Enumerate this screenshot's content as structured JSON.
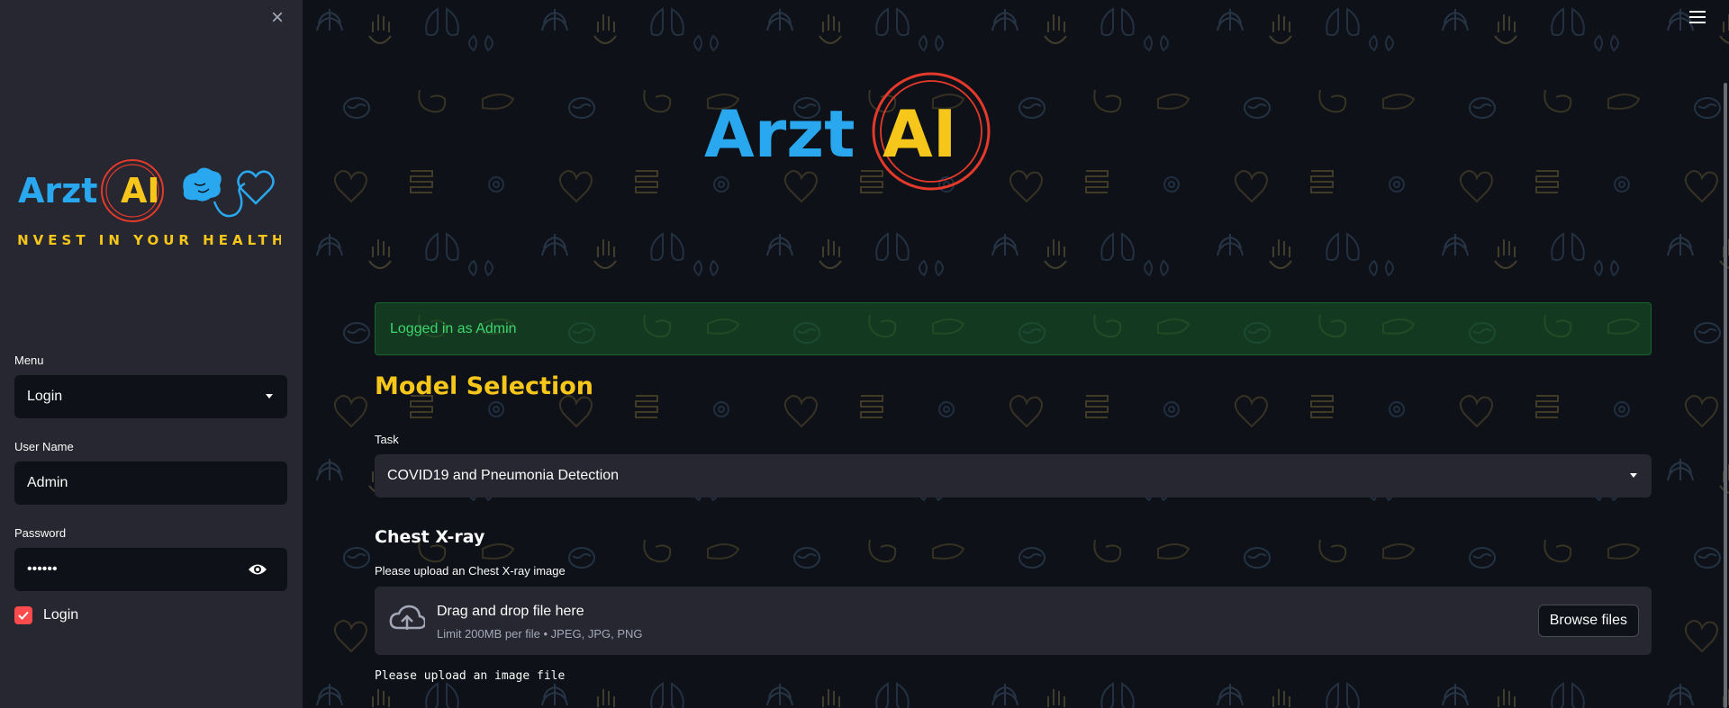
{
  "sidebar": {
    "close_glyph": "×",
    "logo": {
      "word1": "Arzt",
      "word2": "AI",
      "tagline": "INVEST IN YOUR HEALTH",
      "icons": [
        "brain-icon",
        "stethoscope-icon",
        "heart-icon"
      ]
    },
    "menu": {
      "label": "Menu",
      "value": "Login"
    },
    "username": {
      "label": "User Name",
      "value": "Admin"
    },
    "password": {
      "label": "Password",
      "value": "••••••"
    },
    "login_checkbox": {
      "label": "Login",
      "checked": true
    }
  },
  "main": {
    "hero_logo": {
      "word1": "Arzt",
      "word2": "AI"
    },
    "status": {
      "text": "Logged in as Admin"
    },
    "model_selection": {
      "heading": "Model Selection",
      "task_label": "Task",
      "task_value": "COVID19 and Pneumonia Detection"
    },
    "xray": {
      "heading": "Chest X-ray",
      "upload_label": "Please upload an Chest X-ray image",
      "drop_title": "Drag and drop file here",
      "drop_sub": "Limit 200MB per file • JPEG, JPG, PNG",
      "browse_label": "Browse files",
      "message": "Please upload an image file"
    }
  },
  "colors": {
    "brand_blue": "#29a8f0",
    "brand_yellow": "#f7c61a",
    "ring_red": "#e53a2b",
    "success_green": "#3dd56d",
    "checkbox_red": "#ff4b4b",
    "bg_dark": "#0e1117",
    "panel": "#262730"
  }
}
